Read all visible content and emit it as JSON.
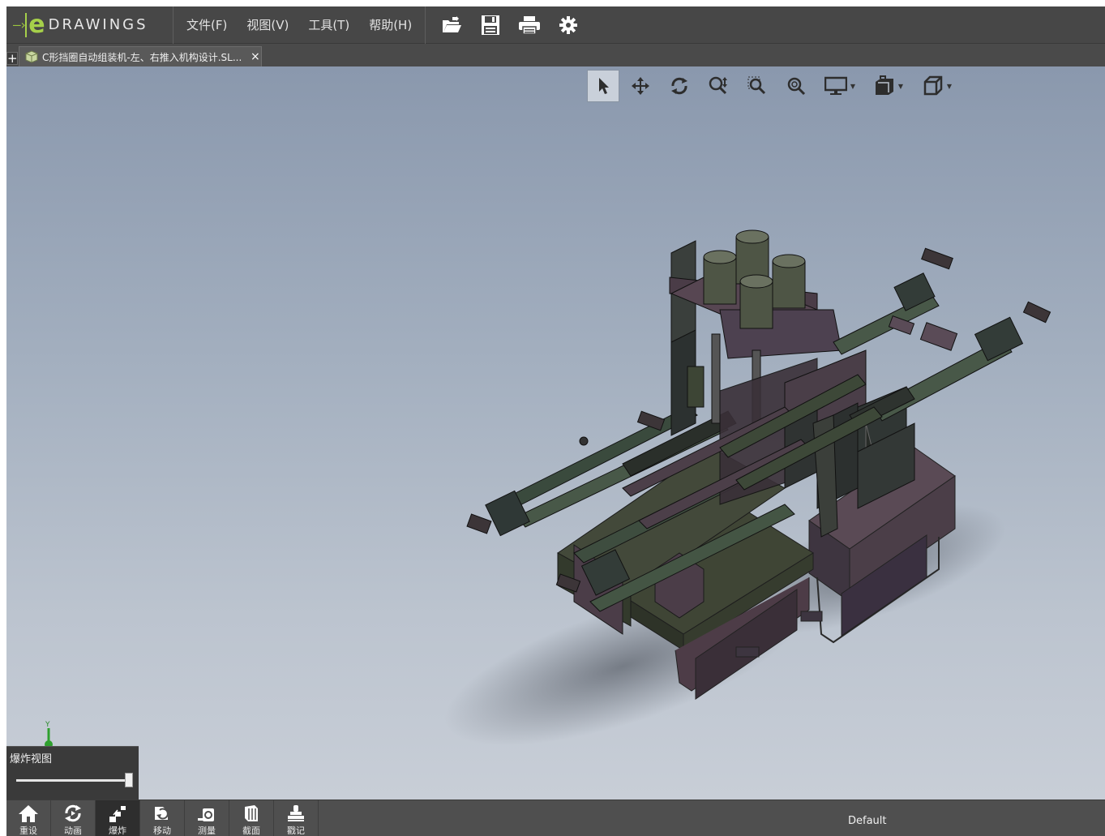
{
  "app": {
    "logo_text": "DRAWINGS",
    "logo_letter": "e",
    "menu": [
      {
        "label": "文件(F)"
      },
      {
        "label": "视图(V)"
      },
      {
        "label": "工具(T)"
      },
      {
        "label": "帮助(H)"
      }
    ],
    "toolbar_icons": [
      "open-folder-icon",
      "save-icon",
      "print-icon",
      "settings-gear-icon"
    ]
  },
  "tab": {
    "add_label": "+",
    "title": "C形挡圈自动组装机-左、右推入机构设计.SL...",
    "close_label": "×"
  },
  "view_toolbar": {
    "icons": [
      "select-arrow-icon",
      "pan-icon",
      "rotate-icon",
      "zoom-icon",
      "zoom-window-icon",
      "zoom-fit-icon",
      "display-style-icon",
      "views-icon",
      "orientation-cube-icon"
    ]
  },
  "triad": {
    "axis_label": "Y"
  },
  "explode_panel": {
    "label": "爆炸视图",
    "value": 1.0
  },
  "bottom_bar": {
    "buttons": [
      {
        "label": "重设",
        "icon": "home-icon"
      },
      {
        "label": "动画",
        "icon": "animate-icon"
      },
      {
        "label": "爆炸",
        "icon": "explode-icon"
      },
      {
        "label": "移动",
        "icon": "move-icon"
      },
      {
        "label": "测量",
        "icon": "measure-icon"
      },
      {
        "label": "截面",
        "icon": "section-icon"
      },
      {
        "label": "戳记",
        "icon": "stamp-icon"
      }
    ],
    "configuration": "Default"
  }
}
